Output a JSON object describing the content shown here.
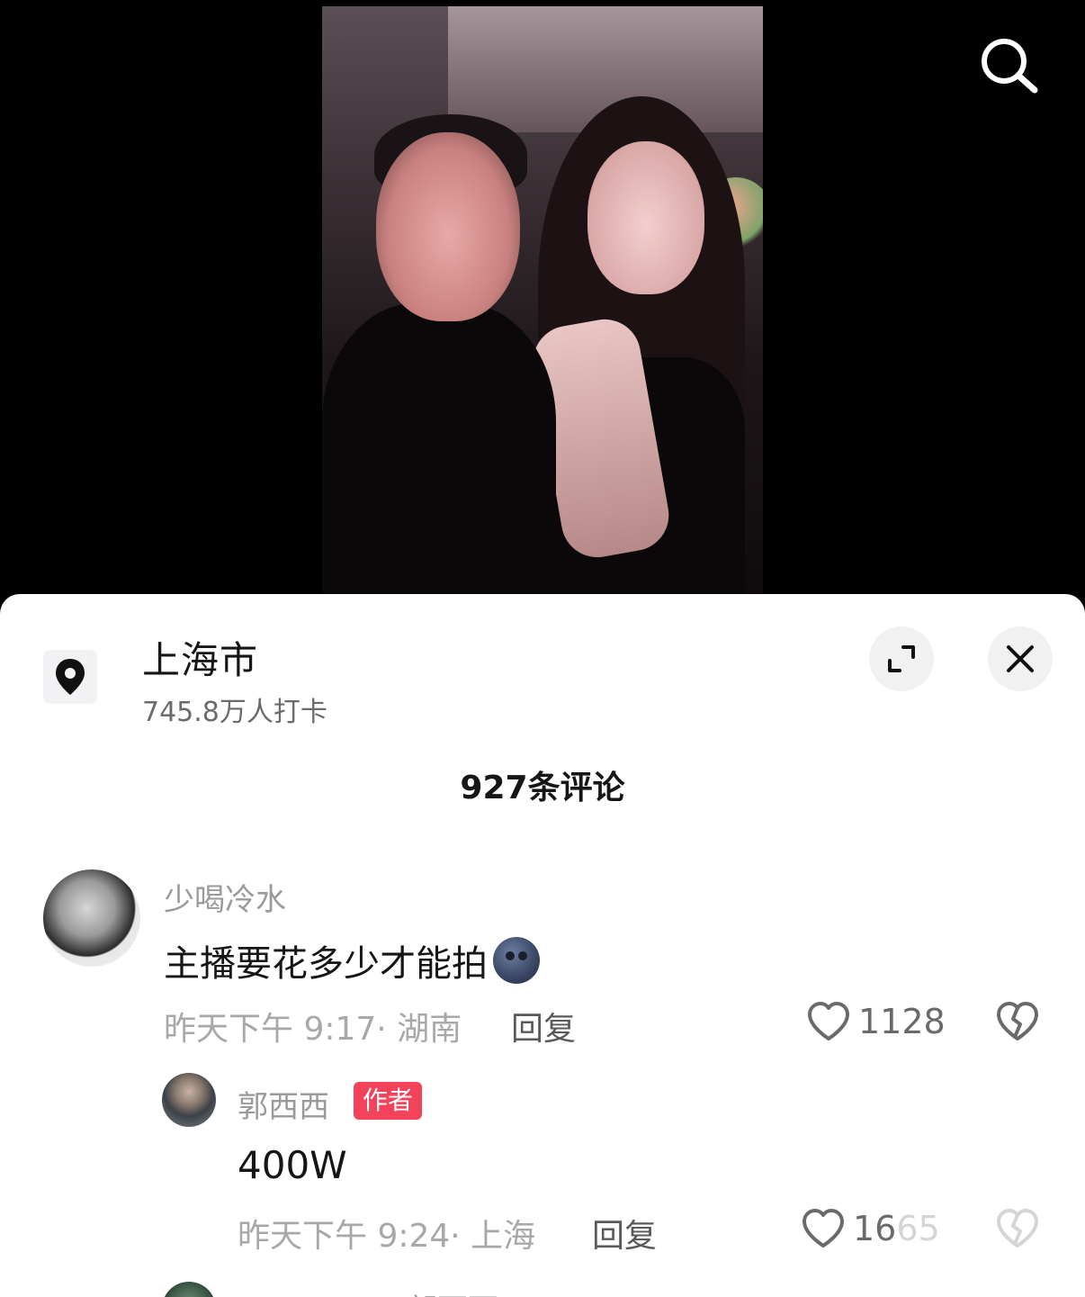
{
  "location": {
    "title": "上海市",
    "checkins": "745.8万人打卡"
  },
  "comments_header": {
    "count_label": "927条评论"
  },
  "comments": [
    {
      "username": "少喝冷水",
      "text": "主播要花多少才能拍",
      "emoji": "new-moon-face-emoji",
      "meta": "昨天下午 9:17· 湖南",
      "reply_label": "回复",
      "likes": "1128"
    },
    {
      "username": "郭西西",
      "badge": "作者",
      "text": "400W",
      "meta": "昨天下午 9:24· 上海",
      "reply_label": "回复",
      "likes": "1665"
    },
    {
      "username": "郭西西"
    }
  ],
  "icons": {
    "search": "search-icon",
    "location": "location-pin-icon",
    "expand": "expand-icon",
    "close": "close-icon",
    "like": "heart-icon",
    "dislike": "broken-heart-icon"
  },
  "colors": {
    "badge": "#f2435a",
    "sheet_bg": "#ffffff",
    "top_bg": "#000000"
  }
}
